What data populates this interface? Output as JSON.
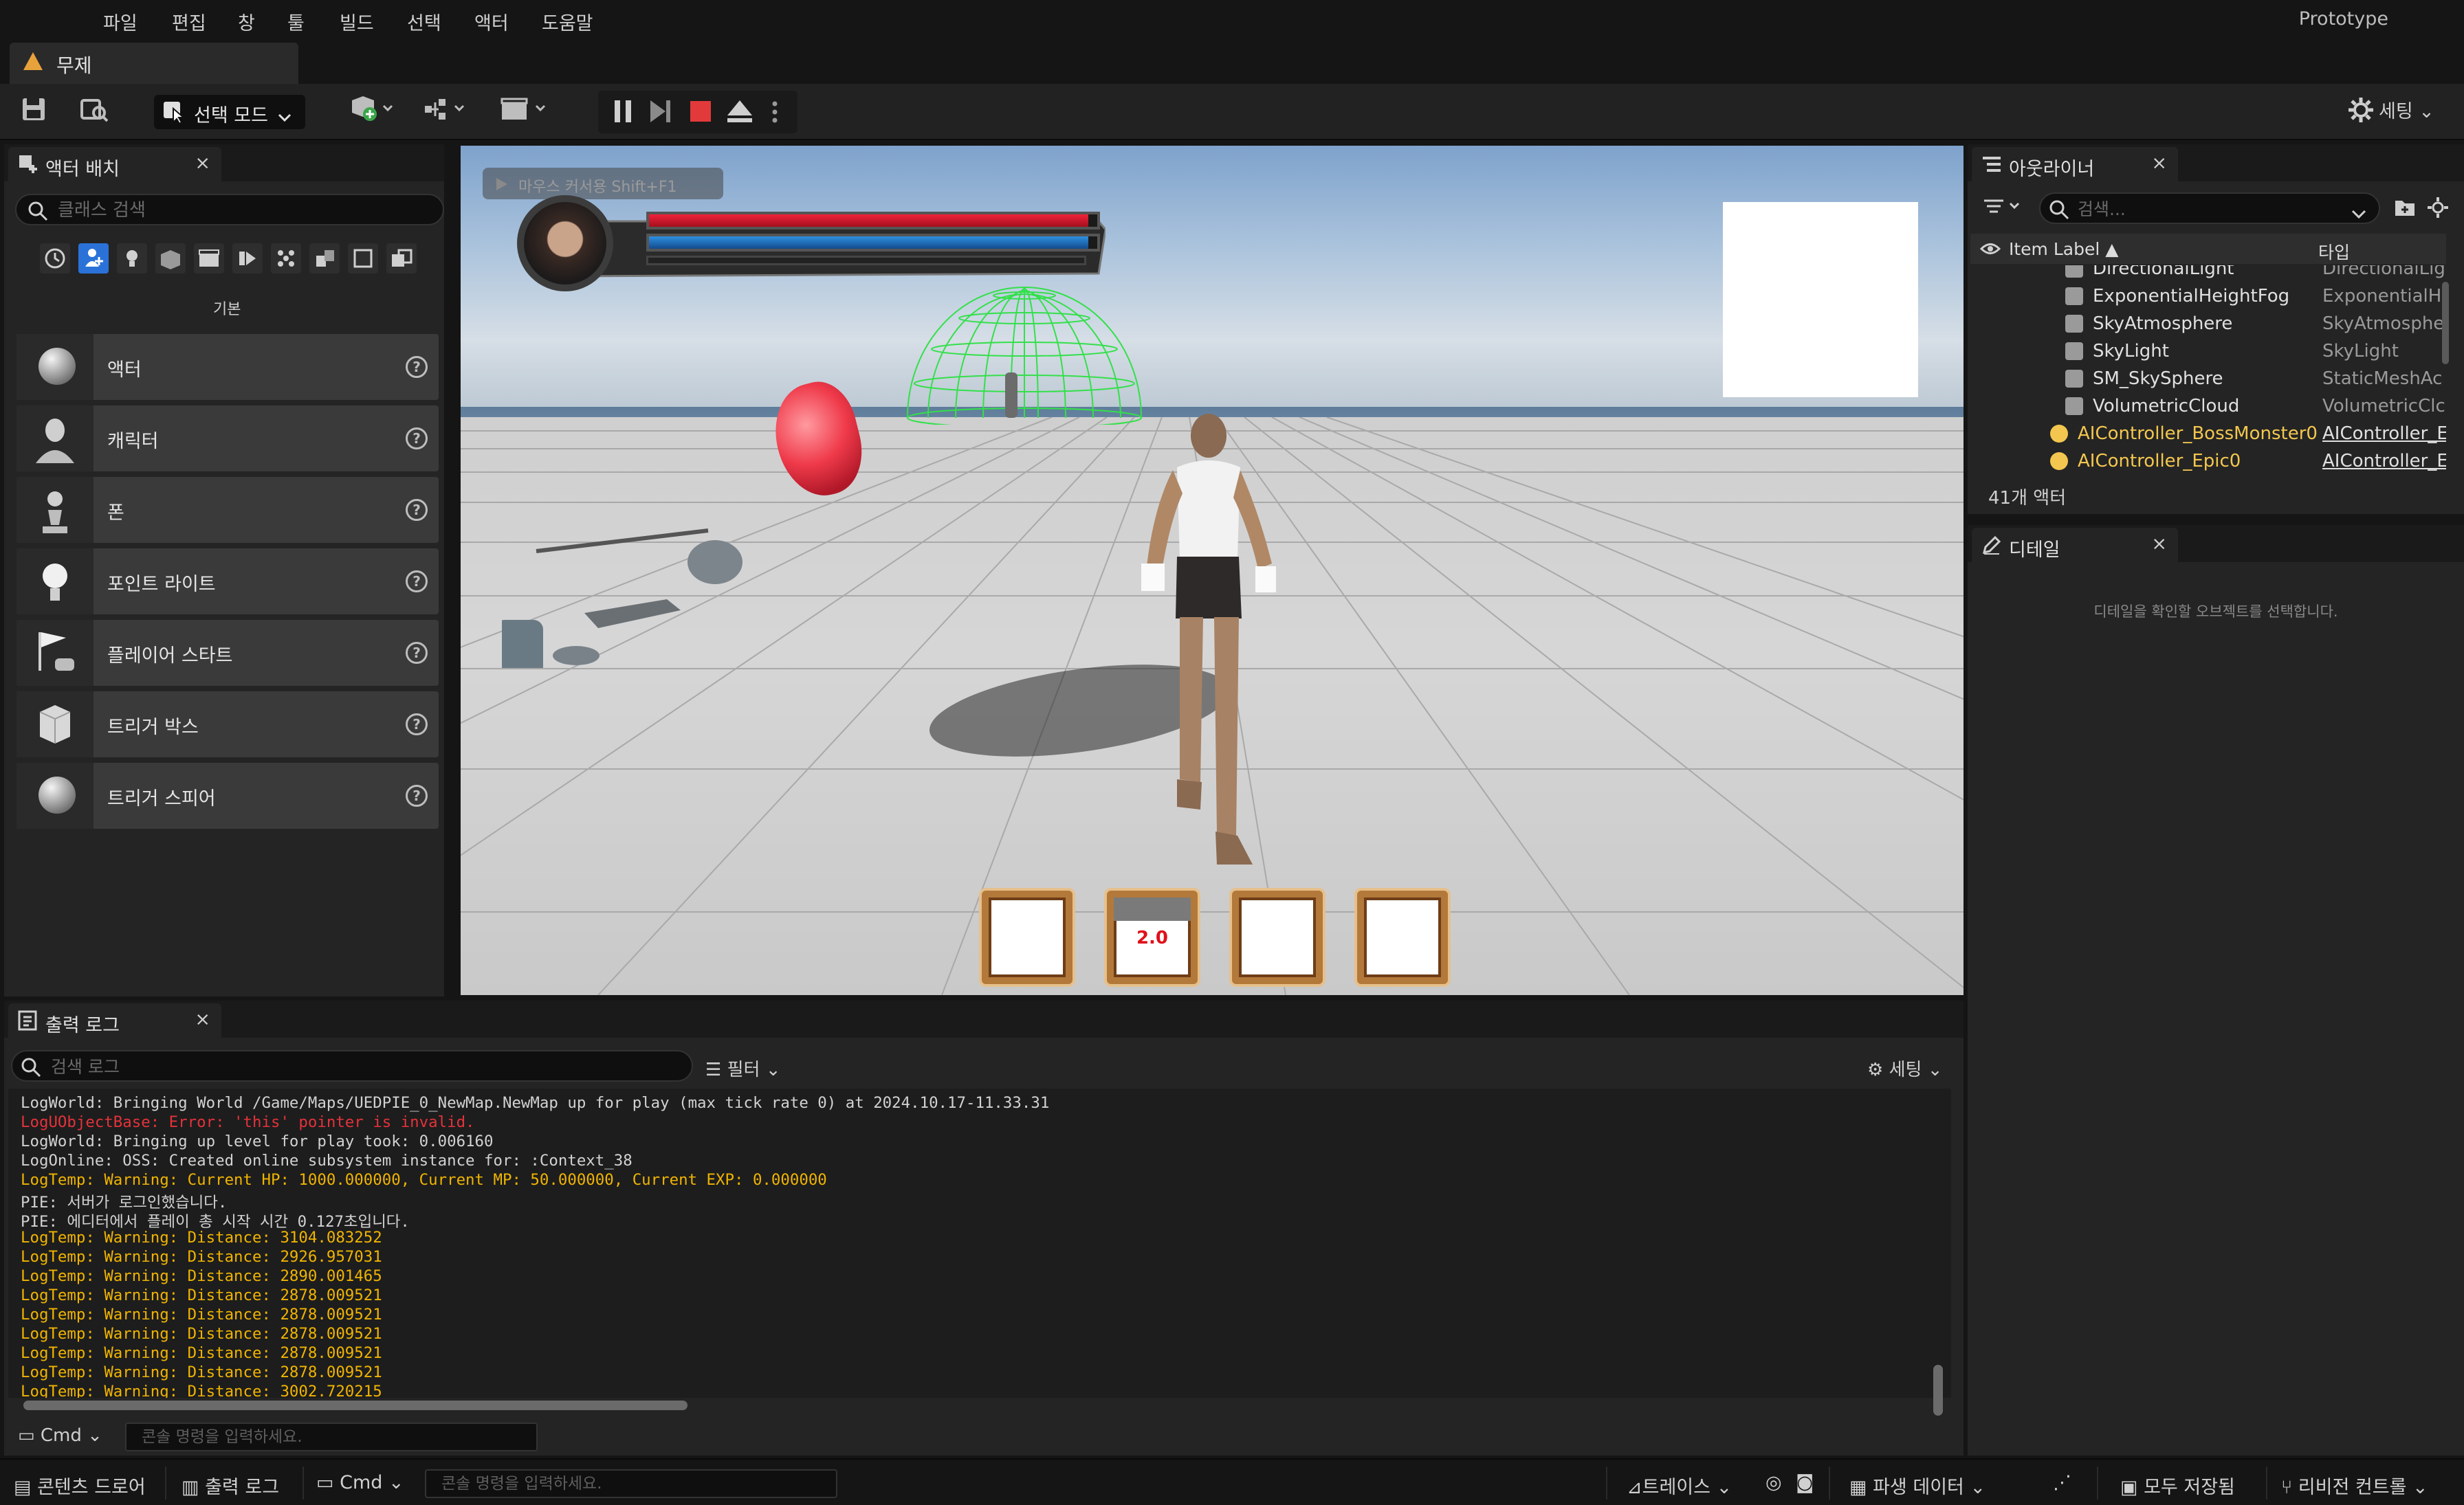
{
  "menu": [
    "파일",
    "편집",
    "창",
    "툴",
    "빌드",
    "선택",
    "액터",
    "도움말"
  ],
  "project_name": "Prototype",
  "level_tab": "무제",
  "toolbar": {
    "select_mode": "선택 모드",
    "settings": "세팅"
  },
  "place_actors": {
    "title": "액터 배치",
    "search_placeholder": "클래스 검색",
    "category": "기본",
    "items": [
      {
        "label": "액터",
        "icon": "sphere-icon"
      },
      {
        "label": "캐릭터",
        "icon": "character-icon"
      },
      {
        "label": "폰",
        "icon": "pawn-icon"
      },
      {
        "label": "포인트 라이트",
        "icon": "lightbulb-icon"
      },
      {
        "label": "플레이어 스타트",
        "icon": "flag-icon"
      },
      {
        "label": "트리거 박스",
        "icon": "cube-icon"
      },
      {
        "label": "트리거 스피어",
        "icon": "sphere-icon"
      }
    ]
  },
  "viewport": {
    "play_hint": "마우스 커서용 Shift+F1",
    "hud": {
      "hp_fraction": 0.98,
      "mp_fraction": 0.98
    },
    "skill_slots": [
      {
        "cooldown": ""
      },
      {
        "cooldown": "2.0"
      },
      {
        "cooldown": ""
      },
      {
        "cooldown": ""
      }
    ]
  },
  "outliner": {
    "title": "아웃라이너",
    "search_placeholder": "검색...",
    "col_label": "Item Label ▲",
    "col_type": "타입",
    "rows": [
      {
        "label": "DirectionalLight",
        "type": "DirectionalLig",
        "kind": "actor"
      },
      {
        "label": "ExponentialHeightFog",
        "type": "ExponentialHe",
        "kind": "actor"
      },
      {
        "label": "SkyAtmosphere",
        "type": "SkyAtmosphe",
        "kind": "actor"
      },
      {
        "label": "SkyLight",
        "type": "SkyLight",
        "kind": "actor"
      },
      {
        "label": "SM_SkySphere",
        "type": "StaticMeshAc",
        "kind": "actor"
      },
      {
        "label": "VolumetricCloud",
        "type": "VolumetricClc",
        "kind": "actor"
      },
      {
        "label": "AIController_BossMonster0",
        "type": "AIController_E",
        "kind": "controller"
      },
      {
        "label": "AIController_Epic0",
        "type": "AIController_E",
        "kind": "controller"
      }
    ],
    "count": "41개 액터"
  },
  "details": {
    "title": "디테일",
    "empty": "디테일을 확인할 오브젝트를 선택합니다."
  },
  "output_log": {
    "title": "출력 로그",
    "search_placeholder": "검색 로그",
    "filter": "필터",
    "settings": "세팅",
    "lines": [
      {
        "text": "LogWorld: Bringing World /Game/Maps/UEDPIE_0_NewMap.NewMap up for play (max tick rate 0) at 2024.10.17-11.33.31",
        "level": "n"
      },
      {
        "text": "LogUObjectBase: Error: 'this' pointer is invalid.",
        "level": "e"
      },
      {
        "text": "LogWorld: Bringing up level for play took: 0.006160",
        "level": "n"
      },
      {
        "text": "LogOnline: OSS: Created online subsystem instance for: :Context_38",
        "level": "n"
      },
      {
        "text": "LogTemp: Warning: Current HP: 1000.000000, Current MP: 50.000000, Current EXP: 0.000000",
        "level": "w"
      },
      {
        "text": "PIE: 서버가 로그인했습니다.",
        "level": "n"
      },
      {
        "text": "PIE: 에디터에서 플레이 총 시작 시간 0.127초입니다.",
        "level": "n"
      },
      {
        "text": "LogTemp: Warning: Distance: 3104.083252",
        "level": "w"
      },
      {
        "text": "LogTemp: Warning: Distance: 2926.957031",
        "level": "w"
      },
      {
        "text": "LogTemp: Warning: Distance: 2890.001465",
        "level": "w"
      },
      {
        "text": "LogTemp: Warning: Distance: 2878.009521",
        "level": "w"
      },
      {
        "text": "LogTemp: Warning: Distance: 2878.009521",
        "level": "w"
      },
      {
        "text": "LogTemp: Warning: Distance: 2878.009521",
        "level": "w"
      },
      {
        "text": "LogTemp: Warning: Distance: 2878.009521",
        "level": "w"
      },
      {
        "text": "LogTemp: Warning: Distance: 2878.009521",
        "level": "w"
      },
      {
        "text": "LogTemp: Warning: Distance: 3002.720215",
        "level": "w"
      }
    ],
    "cmd_label": "Cmd",
    "cmd_placeholder": "콘솔 명령을 입력하세요."
  },
  "statusbar": {
    "content_drawer": "콘텐츠 드로어",
    "output_log": "출력 로그",
    "cmd": "Cmd",
    "cmd_placeholder": "콘솔 명령을 입력하세요.",
    "trace": "트레이스",
    "derived_data": "파생 데이터",
    "save_all": "모두 저장됨",
    "revision_control": "리비전 컨트롤"
  }
}
